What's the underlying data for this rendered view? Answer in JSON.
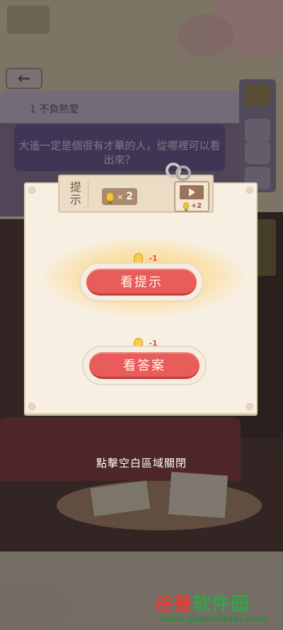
{
  "question": {
    "back_icon": "arrow-left-icon",
    "number": "1",
    "title": "不負熱愛",
    "text": "大遙一定是個很有才華的人，從哪裡可以看出來？"
  },
  "modal": {
    "tab_label": "提示",
    "hint_count_label": "2",
    "hint_count_icon": "lightbulb-icon",
    "video_reward": "+2",
    "video_icon": "play-icon",
    "hint_button": {
      "label": "看提示",
      "cost": "-1"
    },
    "answer_button": {
      "label": "看答案",
      "cost": "-1"
    },
    "accent_color": "#e85c59",
    "glow_color": "#ffc85a"
  },
  "close_hint": "點擊空白區域關閉",
  "watermark": {
    "title_accent": "谷普",
    "title_rest": "软件园",
    "url": "www.gupuxlazal.com"
  }
}
